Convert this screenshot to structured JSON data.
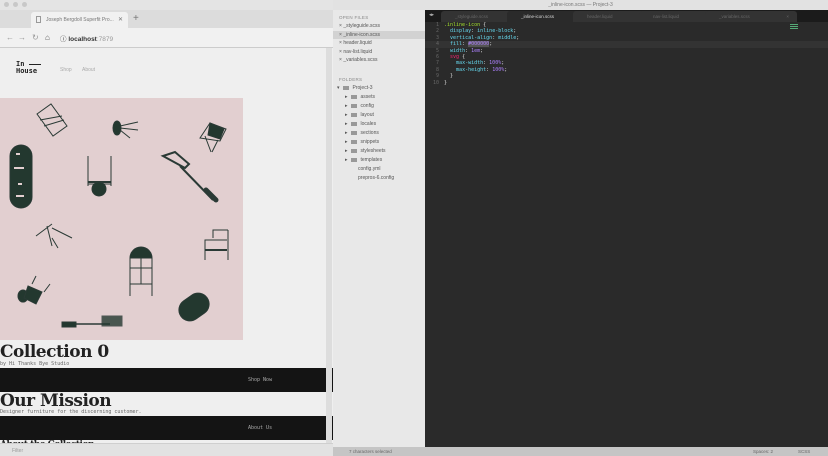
{
  "browser": {
    "tab_title": "Joseph Bergdoll Superfit Pro...",
    "url_host": "localhost",
    "url_port": ":7879",
    "site": {
      "logo_line1": "In",
      "logo_line2": "House",
      "nav": [
        "Shop",
        "About"
      ],
      "collection_title": "Collection 0",
      "collection_sub": "by Hi Thanks Bye Studio",
      "shop_button": "Shop Now",
      "mission_title": "Our Mission",
      "mission_sub": "Designer furniture for the discerning customer.",
      "about_button": "About Us",
      "about_title": "About the Collection",
      "hero_color": "#e2cfd0"
    },
    "status": "Filter"
  },
  "editor": {
    "title": "_inline-icon.scss — Project-3",
    "open_files_header": "OPEN FILES",
    "open_files": [
      "_styleguide.scss",
      "_inline-icon.scss",
      "header.liquid",
      "nav-list.liquid",
      "_variables.scss"
    ],
    "folders_header": "FOLDERS",
    "project": "Project-3",
    "folders": [
      "assets",
      "config",
      "layout",
      "locales",
      "sections",
      "snippets",
      "stylesheets",
      "templates"
    ],
    "files": [
      "config.yml",
      "prepros-6.config"
    ],
    "tabs": [
      "_styleguide.scss",
      "_inline-icon.scss",
      "header.liquid",
      "nav-list.liquid",
      "_variables.scss"
    ],
    "active_tab": 1,
    "code": {
      "selector": ".inline-icon",
      "l2p": "display",
      "l2v": "inline-block",
      "l3p": "vertical-align",
      "l3v": "middle",
      "l4p": "fill",
      "l4v": "#000000",
      "l5p": "width",
      "l5v": "1em",
      "l6s": "svg",
      "l7p": "max-width",
      "l7v": "100%",
      "l8p": "max-height",
      "l8v": "100%"
    },
    "line_numbers": [
      "1",
      "2",
      "3",
      "4",
      "5",
      "6",
      "7",
      "8",
      "9",
      "10"
    ],
    "status_left": "7 characters selected",
    "status_spaces": "Spaces: 2",
    "status_syntax": "SCSS"
  }
}
